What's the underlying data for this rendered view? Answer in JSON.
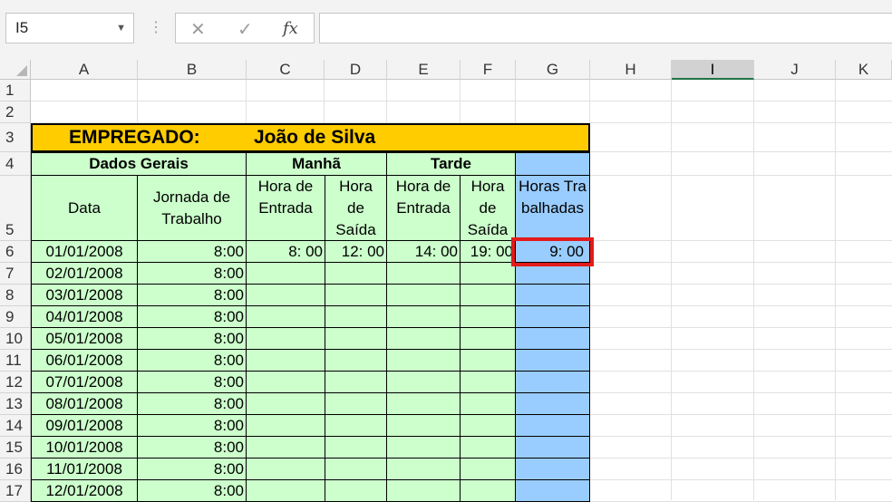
{
  "formula_bar": {
    "name_box": "I5",
    "name_box_arrow": "▼",
    "separator": "⋮",
    "cancel_icon": "✕",
    "enter_icon": "✓",
    "fx_label": "fx",
    "formula": ""
  },
  "columns": [
    "A",
    "B",
    "C",
    "D",
    "E",
    "F",
    "G",
    "H",
    "I",
    "J",
    "K"
  ],
  "rows": [
    "1",
    "2",
    "3",
    "4",
    "5",
    "6",
    "7",
    "8",
    "9",
    "10",
    "11",
    "12",
    "13",
    "14",
    "15",
    "16",
    "17"
  ],
  "sheet": {
    "title_label": "EMPREGADO:",
    "title_name": "João de Silva",
    "group_dados": "Dados Gerais",
    "group_manha": "Manhã",
    "group_tarde": "Tarde",
    "hdr_data": "Data",
    "hdr_jornada": "Jornada de Trabalho",
    "hdr_entrada_m": "Hora de Entrada",
    "hdr_saida_m": "Hora de Saída",
    "hdr_entrada_t": "Hora de Entrada",
    "hdr_saida_t": "Hora de Saída",
    "hdr_horas": "Horas Trabalhadas",
    "data_rows": [
      {
        "date": "01/01/2008",
        "jornada": "8:00",
        "entrada_m": "8: 00",
        "saida_m": "12: 00",
        "entrada_t": "14: 00",
        "saida_t": "19: 00",
        "horas": "9: 00"
      },
      {
        "date": "02/01/2008",
        "jornada": "8:00",
        "entrada_m": "",
        "saida_m": "",
        "entrada_t": "",
        "saida_t": "",
        "horas": ""
      },
      {
        "date": "03/01/2008",
        "jornada": "8:00",
        "entrada_m": "",
        "saida_m": "",
        "entrada_t": "",
        "saida_t": "",
        "horas": ""
      },
      {
        "date": "04/01/2008",
        "jornada": "8:00",
        "entrada_m": "",
        "saida_m": "",
        "entrada_t": "",
        "saida_t": "",
        "horas": ""
      },
      {
        "date": "05/01/2008",
        "jornada": "8:00",
        "entrada_m": "",
        "saida_m": "",
        "entrada_t": "",
        "saida_t": "",
        "horas": ""
      },
      {
        "date": "06/01/2008",
        "jornada": "8:00",
        "entrada_m": "",
        "saida_m": "",
        "entrada_t": "",
        "saida_t": "",
        "horas": ""
      },
      {
        "date": "07/01/2008",
        "jornada": "8:00",
        "entrada_m": "",
        "saida_m": "",
        "entrada_t": "",
        "saida_t": "",
        "horas": ""
      },
      {
        "date": "08/01/2008",
        "jornada": "8:00",
        "entrada_m": "",
        "saida_m": "",
        "entrada_t": "",
        "saida_t": "",
        "horas": ""
      },
      {
        "date": "09/01/2008",
        "jornada": "8:00",
        "entrada_m": "",
        "saida_m": "",
        "entrada_t": "",
        "saida_t": "",
        "horas": ""
      },
      {
        "date": "10/01/2008",
        "jornada": "8:00",
        "entrada_m": "",
        "saida_m": "",
        "entrada_t": "",
        "saida_t": "",
        "horas": ""
      },
      {
        "date": "11/01/2008",
        "jornada": "8:00",
        "entrada_m": "",
        "saida_m": "",
        "entrada_t": "",
        "saida_t": "",
        "horas": ""
      },
      {
        "date": "12/01/2008",
        "jornada": "8:00",
        "entrada_m": "",
        "saida_m": "",
        "entrada_t": "",
        "saida_t": "",
        "horas": ""
      }
    ]
  },
  "colors": {
    "title_fill": "#ffcc00",
    "green_fill": "#ccffcc",
    "blue_fill": "#99ccff",
    "highlight": "#e31b1b",
    "selected_col_accent": "#217346"
  }
}
